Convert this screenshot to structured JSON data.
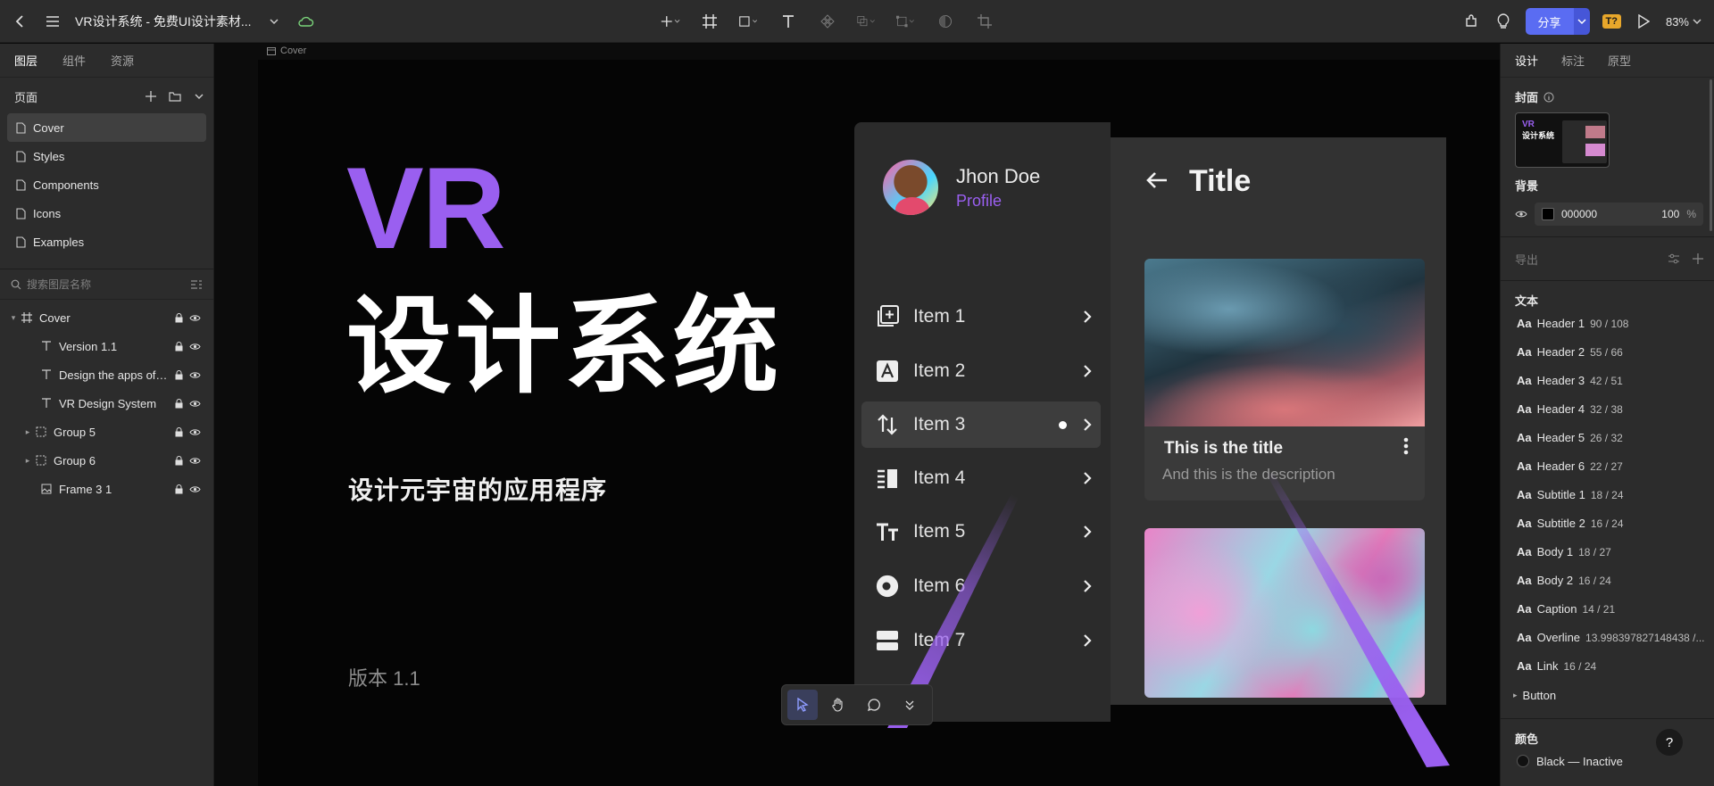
{
  "app": {
    "title": "VR设计系统 - 免费UI设计素材...",
    "share_label": "分享",
    "tq_badge": "T?",
    "zoom": "83%",
    "accent": "#5a6cf2",
    "brand_purple": "#9a5ff0"
  },
  "left_panel": {
    "tabs": [
      "图层",
      "组件",
      "资源"
    ],
    "pages_label": "页面",
    "pages": [
      "Cover",
      "Styles",
      "Components",
      "Icons",
      "Examples"
    ],
    "selected_page": "Cover",
    "search_placeholder": "搜索图层名称",
    "layers": [
      {
        "name": "Cover",
        "icon": "frame-icon",
        "expanded": true
      },
      {
        "name": "Version 1.1",
        "icon": "text-icon"
      },
      {
        "name": "Design the apps of t...",
        "icon": "text-icon"
      },
      {
        "name": "VR Design System",
        "icon": "text-icon"
      },
      {
        "name": "Group 5",
        "icon": "group-icon",
        "collapsed": true
      },
      {
        "name": "Group 6",
        "icon": "group-icon",
        "collapsed": true
      },
      {
        "name": "Frame 3 1",
        "icon": "image-frame-icon"
      }
    ]
  },
  "canvas": {
    "frame_label": "Cover",
    "vr": "VR",
    "title_cn": "设计系统",
    "subtitle_cn": "设计元宇宙的应用程序",
    "version": "版本 1.1",
    "mock": {
      "user_name": "Jhon Doe",
      "user_role": "Profile",
      "menu": [
        {
          "label": "Item 1",
          "icon": "add-box-icon"
        },
        {
          "label": "Item 2",
          "icon": "letter-a-icon"
        },
        {
          "label": "Item 3",
          "icon": "sort-arrows-icon",
          "active": true
        },
        {
          "label": "Item 4",
          "icon": "list-icon"
        },
        {
          "label": "Item 5",
          "icon": "text-size-icon"
        },
        {
          "label": "Item 6",
          "icon": "pie-icon"
        },
        {
          "label": "Item 7",
          "icon": "panels-icon"
        }
      ],
      "detail_title": "Title",
      "card_title": "This is the title",
      "card_desc": "And this is the description"
    }
  },
  "right_panel": {
    "tabs": [
      "设计",
      "标注",
      "原型"
    ],
    "cover_label": "封面",
    "thumb_vr": "VR",
    "thumb_cn": "设计系统",
    "background_label": "背景",
    "bg_hex": "000000",
    "bg_opacity": "100",
    "bg_pct": "%",
    "export_label": "导出",
    "text_label": "文本",
    "aa": "Aa",
    "text_styles": [
      {
        "name": "Header 1",
        "size": "90 / 108"
      },
      {
        "name": "Header 2",
        "size": "55 / 66"
      },
      {
        "name": "Header 3",
        "size": "42 / 51"
      },
      {
        "name": "Header 4",
        "size": "32 / 38"
      },
      {
        "name": "Header 5",
        "size": "26 / 32"
      },
      {
        "name": "Header 6",
        "size": "22 / 27"
      },
      {
        "name": "Subtitle 1",
        "size": "18 / 24"
      },
      {
        "name": "Subtitle 2",
        "size": "16 / 24"
      },
      {
        "name": "Body 1",
        "size": "18 / 27"
      },
      {
        "name": "Body 2",
        "size": "16 / 24"
      },
      {
        "name": "Caption",
        "size": "14 / 21"
      },
      {
        "name": "Overline",
        "size": "13.998397827148438 /..."
      },
      {
        "name": "Link",
        "size": "16 / 24"
      }
    ],
    "button_group": "Button",
    "colors_label": "颜色",
    "first_color": "Black — Inactive",
    "help": "?"
  }
}
